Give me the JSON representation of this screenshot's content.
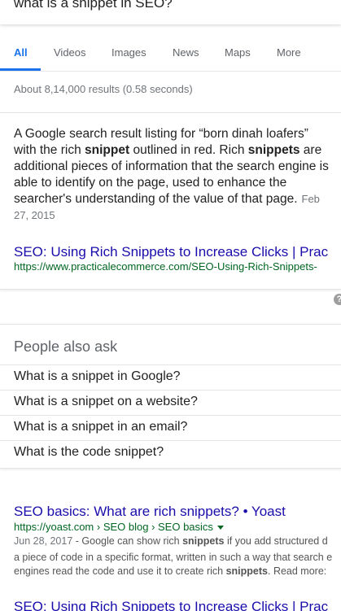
{
  "search": {
    "query": "what is a snippet in SEO?"
  },
  "tabs": [
    "All",
    "Videos",
    "Images",
    "News",
    "Maps",
    "More"
  ],
  "active_tab": "All",
  "results_stats": "About 8,14,000 results (0.58 seconds)",
  "featured_snippet": {
    "text_1": "A Google search result listing for “born dinah loafers” with the rich ",
    "bold_1": "snippet",
    "text_2": " outlined in red. Rich ",
    "bold_2": "snippets",
    "text_3": " are additional pieces of information that the search engine is able to identify on the page, used to enhance the searcher's understanding of the value of that page.",
    "date": "Feb 27, 2015",
    "title": "SEO: Using Rich Snippets to Increase Clicks | Prac",
    "url": "https://www.practicalecommerce.com/SEO-Using-Rich-Snippets-"
  },
  "help_icon_glyph": "?",
  "people_also_ask": {
    "heading": "People also ask",
    "questions": [
      "What is a snippet in Google?",
      "What is a snippet on a website?",
      "What is a snippet in an email?",
      "What is the code snippet?"
    ]
  },
  "results": [
    {
      "title": "SEO basics: What are rich snippets? • Yoast",
      "url": "https://yoast.com › SEO blog › SEO basics",
      "date": "Jun 28, 2017",
      "desc_line_1a": " - Google can show rich ",
      "desc_bold_1": "snippets",
      "desc_line_1b": " if you add structured d",
      "desc_line_2": "a piece of code in a specific format, written in such a way that search e",
      "desc_line_3a": "engines read the code and use it to create rich ",
      "desc_bold_3": "snippets",
      "desc_line_3b": ". Read more:"
    },
    {
      "title": "SEO: Using Rich Snippets to Increase Clicks | Prac"
    }
  ],
  "colors": {
    "link": "#1a0dab",
    "url_green": "#006621",
    "active_tab": "#1a73e8",
    "text": "#222222",
    "muted": "#70757a"
  }
}
